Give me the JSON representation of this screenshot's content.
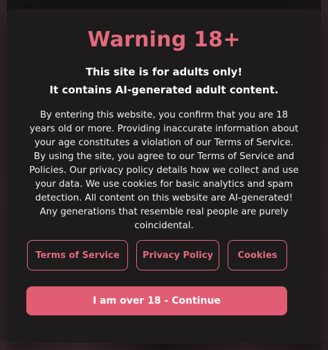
{
  "modal": {
    "title": "Warning 18+",
    "subtitle_line1": "This site is for adults only!",
    "subtitle_line2": "It contains AI-generated adult content.",
    "body": "By entering this website, you confirm that you are 18 years old or more. Providing inaccurate information about your age constitutes a violation of our Terms of Service. By using the site, you agree to our Terms of Service and Policies. Our privacy policy details how we collect and use your data. We use cookies for basic analytics and spam detection. All content on this website are AI-generated! Any generations that resemble real people are purely coincidental."
  },
  "links": {
    "terms_label": "Terms of Service",
    "privacy_label": "Privacy Policy",
    "cookies_label": "Cookies"
  },
  "actions": {
    "continue_label": "I am over 18 - Continue"
  },
  "colors": {
    "accent": "#e36a7e",
    "continue_bg": "#e05d73",
    "modal_bg": "#1d1b1c"
  }
}
